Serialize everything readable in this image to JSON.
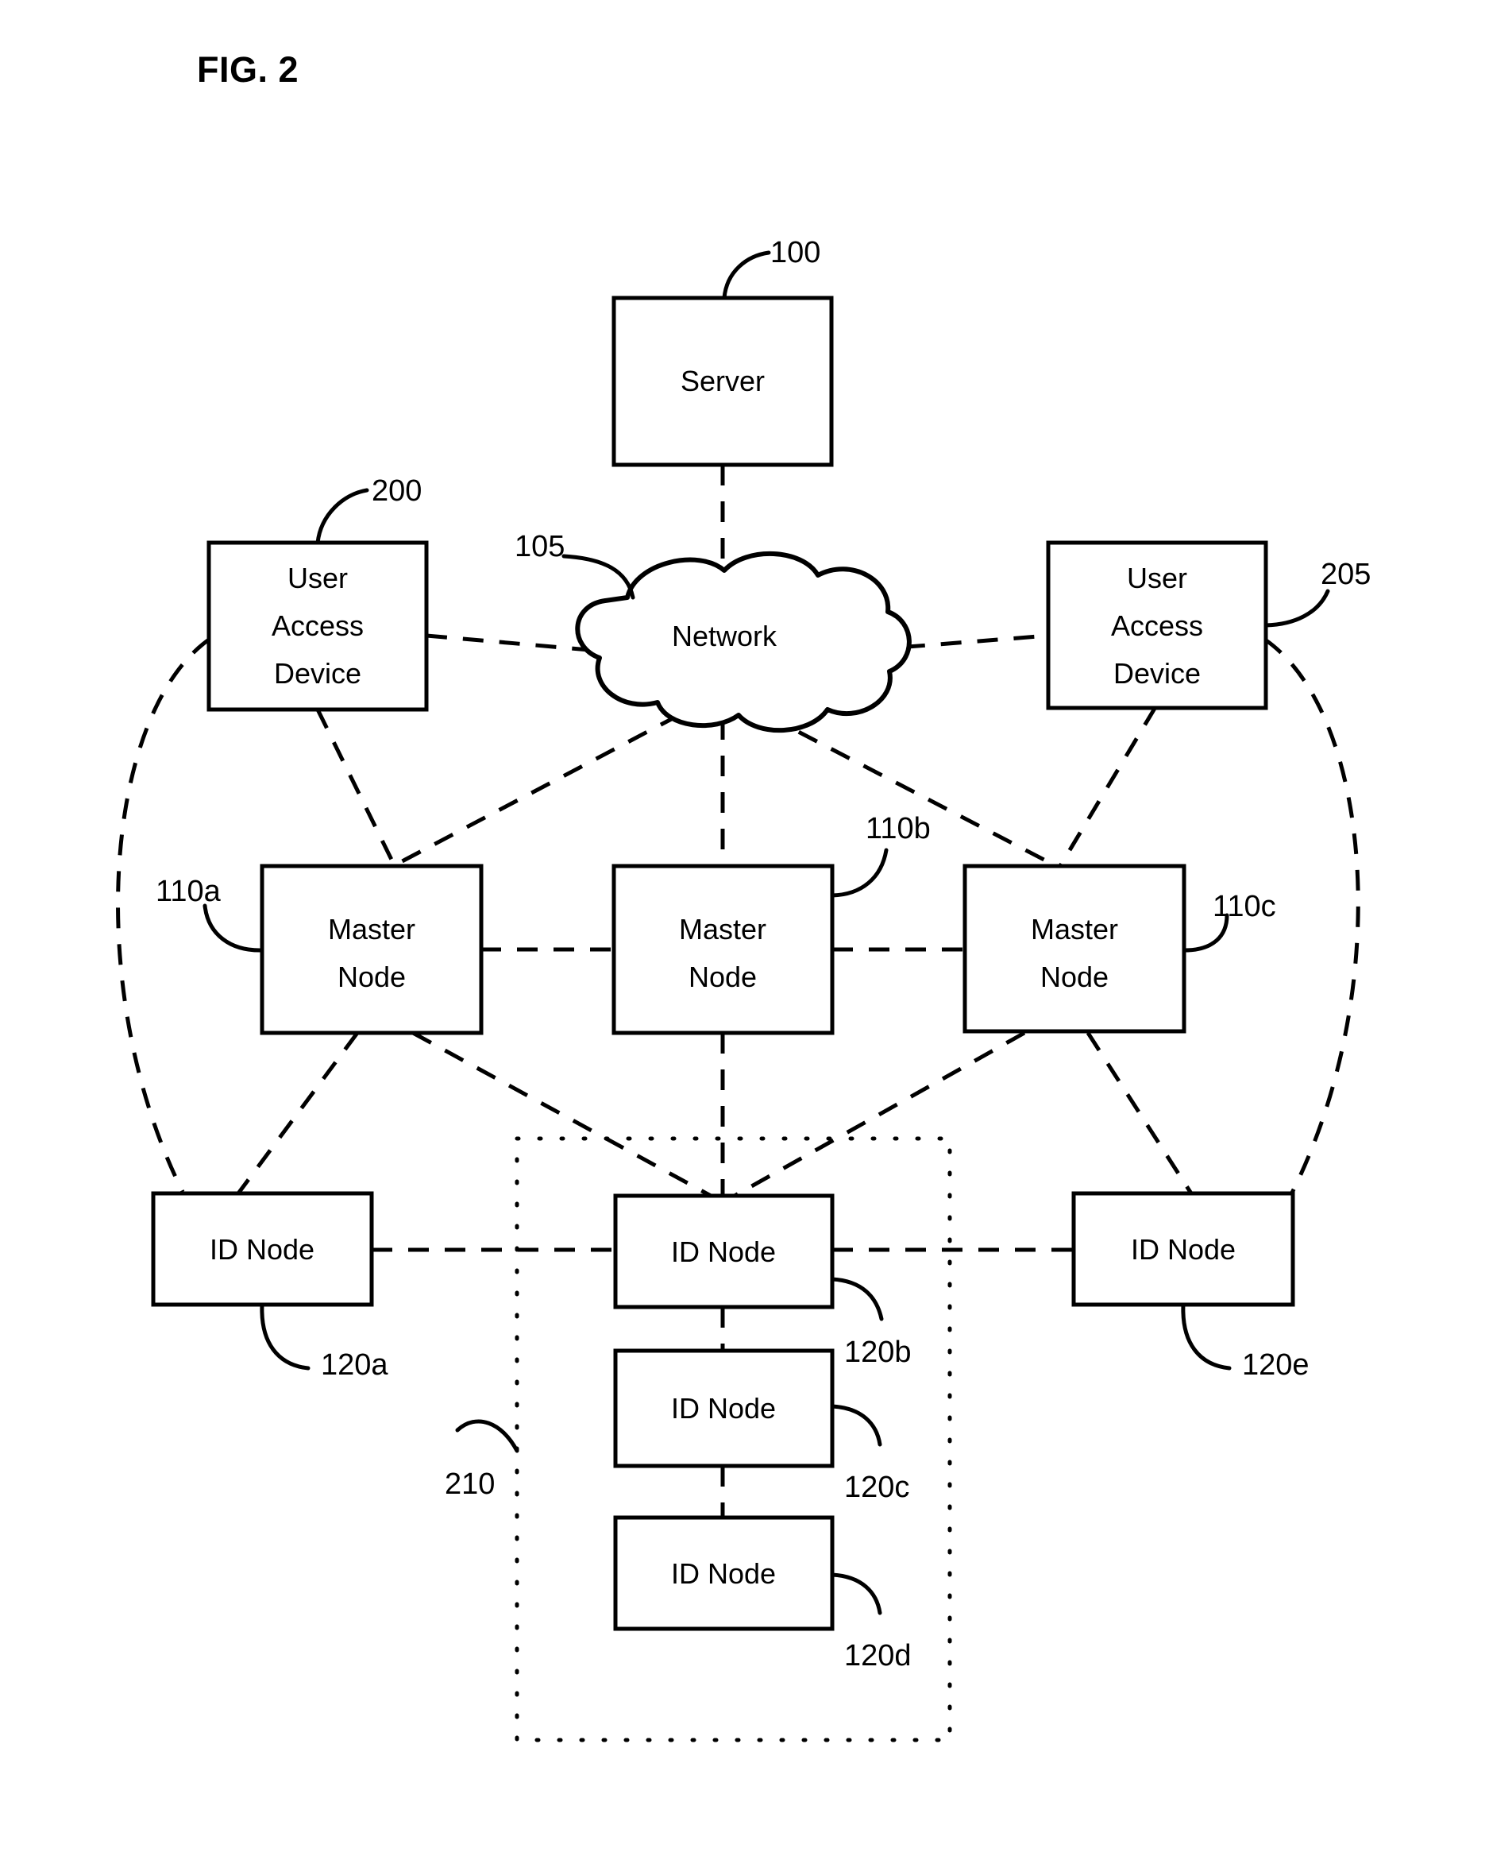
{
  "figure": {
    "title": "FIG. 2",
    "domain": "patent-network-diagram"
  },
  "nodes": {
    "server": {
      "label": "Server",
      "ref": "100"
    },
    "network": {
      "label": "Network",
      "ref": "105"
    },
    "user_access_device_left": {
      "label_line1": "User",
      "label_line2": "Access",
      "label_line3": "Device",
      "ref": "200"
    },
    "user_access_device_right": {
      "label_line1": "User",
      "label_line2": "Access",
      "label_line3": "Device",
      "ref": "205"
    },
    "master_node_a": {
      "label_line1": "Master",
      "label_line2": "Node",
      "ref": "110a"
    },
    "master_node_b": {
      "label_line1": "Master",
      "label_line2": "Node",
      "ref": "110b"
    },
    "master_node_c": {
      "label_line1": "Master",
      "label_line2": "Node",
      "ref": "110c"
    },
    "id_node_a": {
      "label": "ID Node",
      "ref": "120a"
    },
    "id_node_b": {
      "label": "ID Node",
      "ref": "120b"
    },
    "id_node_c": {
      "label": "ID Node",
      "ref": "120c"
    },
    "id_node_d": {
      "label": "ID Node",
      "ref": "120d"
    },
    "id_node_e": {
      "label": "ID Node",
      "ref": "120e"
    },
    "group_region": {
      "ref": "210"
    }
  },
  "colors": {
    "stroke": "#000000",
    "fill": "#ffffff",
    "background": "#ffffff"
  }
}
